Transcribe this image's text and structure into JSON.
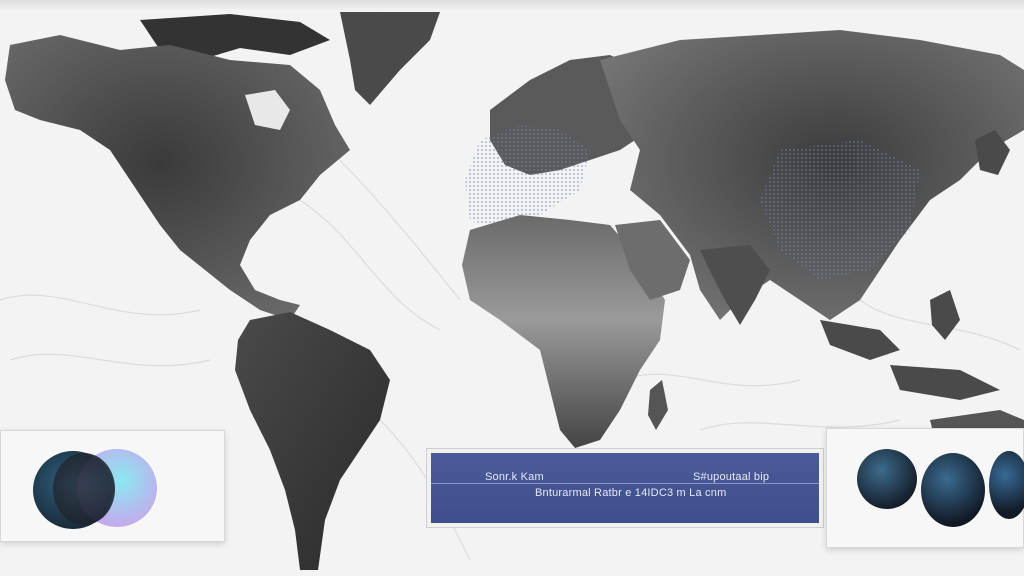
{
  "map": {
    "style": "grayscale world map",
    "colors": {
      "ocean": "#f3f3f3",
      "land": "#555555",
      "land_dark": "#2e2e2e",
      "land_light": "#8a8a8a",
      "highlight": "#5d6fa8",
      "panel_blue": "#45549a"
    }
  },
  "info_panel": {
    "title": "Sonr.k Kam",
    "right_label": "S#upoutaal bip",
    "subtitle": "Bnturarmal Ratbr e 14IDC3 m La cnm"
  },
  "legend_left": {
    "icon": "overlapping-spheres-icon"
  },
  "legend_right": {
    "icon": "three-spheres-icon"
  }
}
